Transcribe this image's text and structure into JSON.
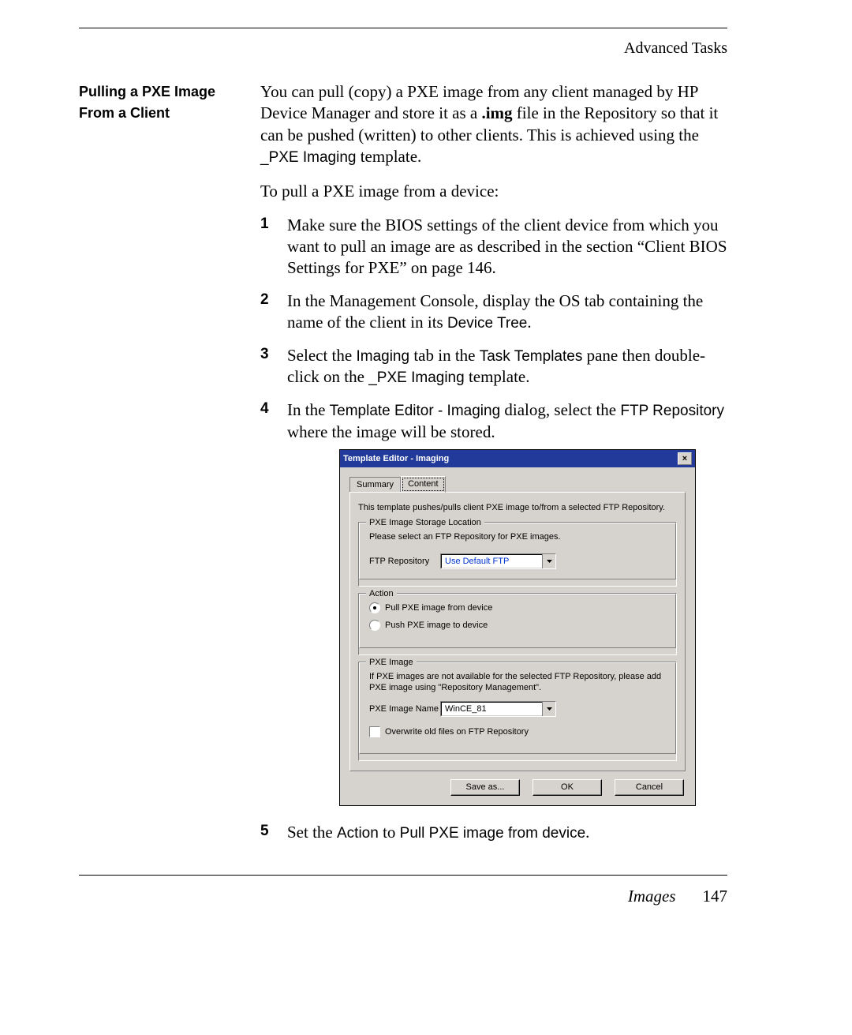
{
  "header": {
    "section_label": "Advanced Tasks"
  },
  "sidehead": "Pulling a PXE Image From a Client",
  "intro": {
    "pre": "You can pull (copy) a PXE image from any client managed by HP Device Manager and store it as a ",
    "bold": ".img",
    "post": " file in the Repository so that it can be pushed (written) to other clients. This is achieved using the ",
    "template_name": "_PXE Imaging",
    "post2": " template."
  },
  "lead": "To pull a PXE image from a device:",
  "steps": {
    "s1": "Make sure the BIOS settings of the client device from which you want to pull an image are as described in the section “Client BIOS Settings for PXE” on page 146.",
    "s2": {
      "pre": "In the Management Console, display the OS tab containing the name of the client in its ",
      "tt": "Device Tree",
      "post": "."
    },
    "s3": {
      "pre": "Select the ",
      "tt1": "Imaging",
      "mid": " tab in the ",
      "tt2": "Task Templates",
      "mid2": " pane then double-click on the ",
      "tt3": "_PXE Imaging",
      "post": " template."
    },
    "s4": {
      "pre": "In the ",
      "tt1": "Template Editor - Imaging",
      "mid": " dialog, select the ",
      "tt2": "FTP Repository",
      "post": " where the image will be stored."
    },
    "s5": {
      "pre": "Set the ",
      "tt1": "Action",
      "mid": " to ",
      "tt2": "Pull PXE image from device",
      "post": "."
    }
  },
  "dialog": {
    "title": "Template Editor - Imaging",
    "tabs": {
      "summary": "Summary",
      "content": "Content"
    },
    "description": "This template pushes/pulls client PXE image to/from a selected FTP Repository.",
    "group_storage": {
      "legend": "PXE Image Storage Location",
      "hint": "Please select an FTP Repository for PXE images.",
      "label": "FTP Repository",
      "value": "Use Default FTP"
    },
    "group_action": {
      "legend": "Action",
      "opt_pull": "Pull PXE image from device",
      "opt_push": "Push PXE image to device"
    },
    "group_image": {
      "legend": "PXE Image",
      "hint": "If PXE images are not available for the selected FTP Repository, please add PXE image using \"Repository Management\".",
      "label": "PXE Image Name",
      "value": "WinCE_81",
      "overwrite": "Overwrite old files on FTP Repository"
    },
    "buttons": {
      "saveas": "Save as...",
      "ok": "OK",
      "cancel": "Cancel"
    }
  },
  "footer": {
    "label": "Images",
    "page": "147"
  }
}
